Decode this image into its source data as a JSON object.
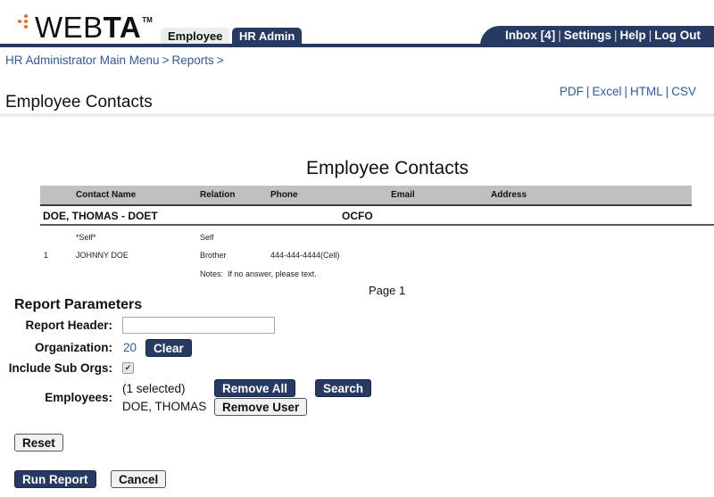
{
  "header": {
    "logo": {
      "text_light": "WEB",
      "text_bold": "TA",
      "trademark": "TM",
      "dot_color": "#f26a2a"
    },
    "tabs": [
      {
        "label": "Employee",
        "active": false
      },
      {
        "label": "HR Admin",
        "active": true
      }
    ],
    "utility_nav": [
      {
        "label": "Inbox [4]"
      },
      {
        "label": "Settings"
      },
      {
        "label": "Help"
      },
      {
        "label": "Log Out"
      }
    ],
    "separator": "|",
    "brand_color": "#263a63"
  },
  "breadcrumb": {
    "items": [
      "HR Administrator Main Menu",
      "Reports"
    ],
    "separator": ">"
  },
  "page": {
    "title": "Employee Contacts",
    "export_links": [
      "PDF",
      "Excel",
      "HTML",
      "CSV"
    ],
    "export_separator": "|"
  },
  "report": {
    "title": "Employee Contacts",
    "columns": [
      "Contact Name",
      "Relation",
      "Phone",
      "Email",
      "Address"
    ],
    "employee": {
      "name": "DOE, THOMAS - DOET",
      "org": "OCFO"
    },
    "contacts": [
      {
        "index": "",
        "name": "*Self*",
        "relation": "Self",
        "phone": "",
        "email": "",
        "address": ""
      },
      {
        "index": "1",
        "name": "JOHNNY DOE",
        "relation": "Brother",
        "phone": "444-444-4444(Cell)",
        "email": "",
        "address": ""
      }
    ],
    "notes": "Notes:  If no answer, please text.",
    "page_label": "Page 1"
  },
  "parameters": {
    "title": "Report Parameters",
    "report_header": {
      "label": "Report Header:",
      "value": "",
      "placeholder": ""
    },
    "organization": {
      "label": "Organization:",
      "value": "20",
      "clear_label": "Clear"
    },
    "include_sub_orgs": {
      "label": "Include Sub Orgs:",
      "checked": true,
      "check_glyph": "✔"
    },
    "employees": {
      "label": "Employees:",
      "selected_count": "(1 selected)",
      "selected_name": "DOE, THOMAS",
      "remove_all_label": "Remove All",
      "search_label": "Search",
      "remove_user_label": "Remove User"
    },
    "reset_label": "Reset",
    "run_report_label": "Run Report",
    "cancel_label": "Cancel"
  }
}
